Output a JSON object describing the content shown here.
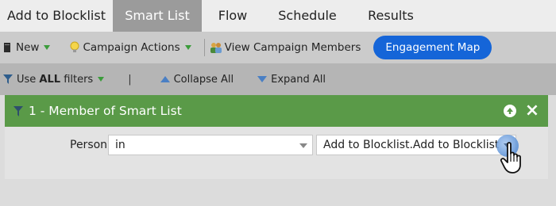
{
  "tabs": [
    {
      "label": "Add to Blocklist",
      "active": false
    },
    {
      "label": "Smart List",
      "active": true
    },
    {
      "label": "Flow",
      "active": false
    },
    {
      "label": "Schedule",
      "active": false
    },
    {
      "label": "Results",
      "active": false
    }
  ],
  "toolbar": {
    "new_label": "New",
    "campaign_actions_label": "Campaign Actions",
    "view_members_label": "View Campaign Members",
    "engagement_map_label": "Engagement Map"
  },
  "filterbar": {
    "use_prefix": "Use ",
    "use_bold": "ALL",
    "use_suffix": " filters",
    "separator": "|",
    "collapse_label": "Collapse All",
    "expand_label": "Expand All"
  },
  "filter": {
    "title": "1 - Member of Smart List",
    "person_label": "Person:",
    "operator_value": "in",
    "list_value": "Add to Blocklist.Add to Blocklist"
  },
  "colors": {
    "active_tab": "#9b9b9b",
    "engagement_button": "#1565d8",
    "filter_header": "#5a9a48"
  }
}
